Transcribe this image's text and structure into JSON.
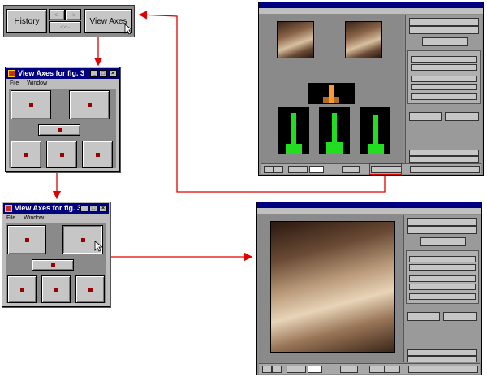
{
  "toolbar": {
    "history_label": "History",
    "back_glyph": "<-",
    "forward_glyph": "->",
    "first_glyph": "<<-",
    "view_axes_label": "View Axes"
  },
  "dialog1": {
    "title": "View Axes for fig. 3",
    "menu": [
      "File",
      "Window"
    ]
  },
  "dialog2": {
    "title": "View Axes for fig. 3",
    "menu": [
      "File",
      "Window"
    ]
  },
  "colors": {
    "accent_red": "#e00000",
    "title_blue": "#000080",
    "dot_red": "#990000",
    "hist_green": "#22dd22",
    "hist_orange": "#ff9933"
  },
  "icons": [
    "mouse-pointer-icon",
    "window-icon",
    "minimize-icon",
    "maximize-icon",
    "close-icon"
  ]
}
